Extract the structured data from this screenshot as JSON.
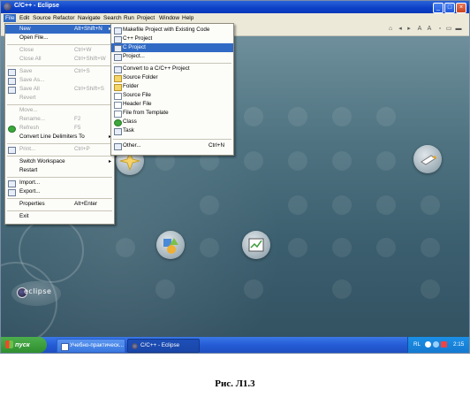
{
  "window": {
    "title": "C/C++ - Eclipse"
  },
  "menubar": {
    "items": [
      "File",
      "Edit",
      "Source",
      "Refactor",
      "Navigate",
      "Search",
      "Run",
      "Project",
      "Window",
      "Help"
    ],
    "active": "File"
  },
  "file_menu": {
    "items": [
      {
        "label": "New",
        "shortcut": "Alt+Shift+N",
        "submenu": true,
        "enabled": true,
        "selected": true
      },
      {
        "label": "Open File...",
        "enabled": true
      },
      {
        "label": "Close",
        "shortcut": "Ctrl+W",
        "enabled": false
      },
      {
        "label": "Close All",
        "shortcut": "Ctrl+Shift+W",
        "enabled": false
      },
      {
        "label": "Save",
        "shortcut": "Ctrl+S",
        "enabled": false,
        "icon": "save-icon"
      },
      {
        "label": "Save As...",
        "enabled": false,
        "icon": "save-as-icon"
      },
      {
        "label": "Save All",
        "shortcut": "Ctrl+Shift+S",
        "enabled": false,
        "icon": "save-all-icon"
      },
      {
        "label": "Revert",
        "enabled": false
      },
      {
        "label": "Move...",
        "enabled": false
      },
      {
        "label": "Rename...",
        "shortcut": "F2",
        "enabled": false
      },
      {
        "label": "Refresh",
        "shortcut": "F5",
        "enabled": false,
        "icon": "refresh-icon"
      },
      {
        "label": "Convert Line Delimiters To",
        "submenu": true,
        "enabled": true
      },
      {
        "label": "Print...",
        "shortcut": "Ctrl+P",
        "enabled": false,
        "icon": "print-icon"
      },
      {
        "label": "Switch Workspace",
        "submenu": true,
        "enabled": true
      },
      {
        "label": "Restart",
        "enabled": true
      },
      {
        "label": "Import...",
        "enabled": true,
        "icon": "import-icon"
      },
      {
        "label": "Export...",
        "enabled": true,
        "icon": "export-icon"
      },
      {
        "label": "Properties",
        "shortcut": "Alt+Enter",
        "enabled": true
      },
      {
        "label": "Exit",
        "enabled": true
      }
    ]
  },
  "new_submenu": {
    "items": [
      {
        "label": "Makefile Project with Existing Code",
        "icon": "makefile-project-icon"
      },
      {
        "label": "C++ Project",
        "icon": "cpp-project-icon"
      },
      {
        "label": "C Project",
        "icon": "c-project-icon",
        "selected": true
      },
      {
        "label": "Project...",
        "icon": "project-icon"
      },
      {
        "label": "Convert to a C/C++ Project",
        "icon": "convert-icon"
      },
      {
        "label": "Source Folder",
        "icon": "source-folder-icon"
      },
      {
        "label": "Folder",
        "icon": "folder-icon"
      },
      {
        "label": "Source File",
        "icon": "source-file-icon"
      },
      {
        "label": "Header File",
        "icon": "header-file-icon"
      },
      {
        "label": "File from Template",
        "icon": "template-file-icon"
      },
      {
        "label": "Class",
        "icon": "class-icon"
      },
      {
        "label": "Task",
        "icon": "task-icon"
      },
      {
        "label": "Other...",
        "shortcut": "Ctrl+N",
        "icon": "other-icon"
      }
    ]
  },
  "welcome": {
    "logo_text": "eclipse",
    "icons": [
      "tutorials-icon",
      "overview-icon",
      "samples-icon",
      "whats-new-icon",
      "workbench-icon"
    ]
  },
  "taskbar": {
    "start_label": "пуск",
    "tasks": [
      {
        "label": "Учебно-практическ...",
        "icon": "word-document-icon"
      },
      {
        "label": "C/C++ - Eclipse",
        "icon": "eclipse-icon"
      }
    ],
    "tray": {
      "language": "RL",
      "time": "2:15"
    }
  },
  "caption": "Рис. Л1.3"
}
